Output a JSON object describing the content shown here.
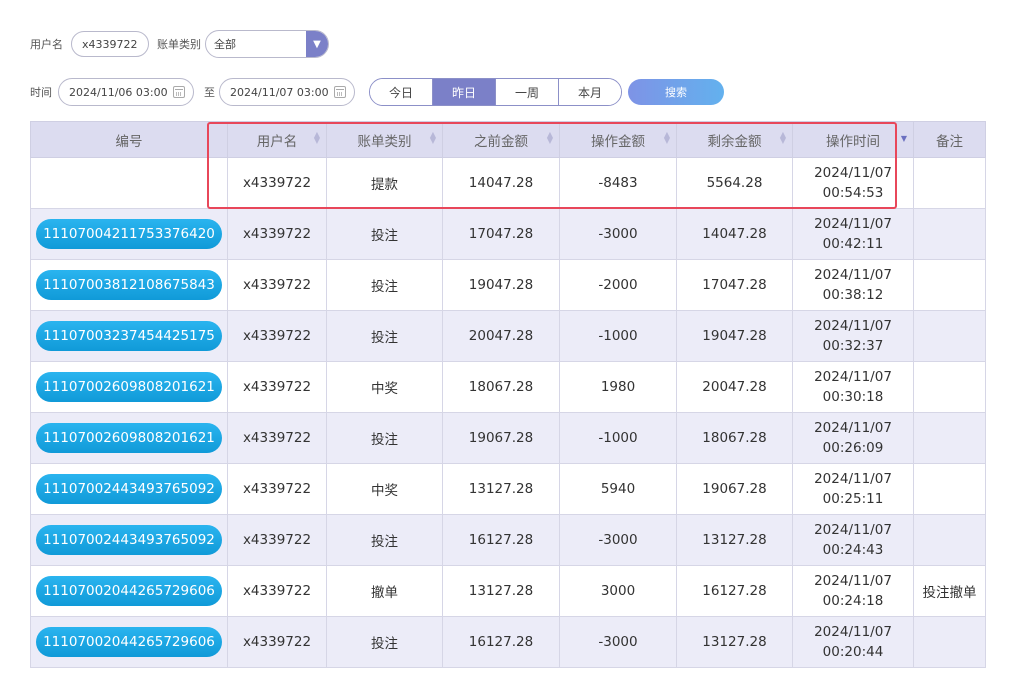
{
  "filters": {
    "username_label": "用户名",
    "username_value": "x4339722",
    "category_label": "账单类别",
    "category_value": "全部",
    "time_label": "时间",
    "start_date": "2024/11/06 03:00",
    "to_label": "至",
    "end_date": "2024/11/07 03:00",
    "quick_ranges": [
      "今日",
      "昨日",
      "一周",
      "本月"
    ],
    "active_range": "昨日",
    "search_label": "搜索"
  },
  "table": {
    "columns": [
      "编号",
      "用户名",
      "账单类别",
      "之前金额",
      "操作金额",
      "剩余金额",
      "操作时间",
      "备注"
    ],
    "rows": [
      {
        "id": "",
        "user": "x4339722",
        "type": "提款",
        "before": "14047.28",
        "amount": "-8483",
        "after": "5564.28",
        "date": "2024/11/07",
        "time": "00:54:53",
        "note": ""
      },
      {
        "id": "11107004211753376420",
        "user": "x4339722",
        "type": "投注",
        "before": "17047.28",
        "amount": "-3000",
        "after": "14047.28",
        "date": "2024/11/07",
        "time": "00:42:11",
        "note": ""
      },
      {
        "id": "11107003812108675843",
        "user": "x4339722",
        "type": "投注",
        "before": "19047.28",
        "amount": "-2000",
        "after": "17047.28",
        "date": "2024/11/07",
        "time": "00:38:12",
        "note": ""
      },
      {
        "id": "11107003237454425175",
        "user": "x4339722",
        "type": "投注",
        "before": "20047.28",
        "amount": "-1000",
        "after": "19047.28",
        "date": "2024/11/07",
        "time": "00:32:37",
        "note": ""
      },
      {
        "id": "11107002609808201621",
        "user": "x4339722",
        "type": "中奖",
        "before": "18067.28",
        "amount": "1980",
        "after": "20047.28",
        "date": "2024/11/07",
        "time": "00:30:18",
        "note": ""
      },
      {
        "id": "11107002609808201621",
        "user": "x4339722",
        "type": "投注",
        "before": "19067.28",
        "amount": "-1000",
        "after": "18067.28",
        "date": "2024/11/07",
        "time": "00:26:09",
        "note": ""
      },
      {
        "id": "11107002443493765092",
        "user": "x4339722",
        "type": "中奖",
        "before": "13127.28",
        "amount": "5940",
        "after": "19067.28",
        "date": "2024/11/07",
        "time": "00:25:11",
        "note": ""
      },
      {
        "id": "11107002443493765092",
        "user": "x4339722",
        "type": "投注",
        "before": "16127.28",
        "amount": "-3000",
        "after": "13127.28",
        "date": "2024/11/07",
        "time": "00:24:43",
        "note": ""
      },
      {
        "id": "11107002044265729606",
        "user": "x4339722",
        "type": "撤单",
        "before": "13127.28",
        "amount": "3000",
        "after": "16127.28",
        "date": "2024/11/07",
        "time": "00:24:18",
        "note": "投注撤单"
      },
      {
        "id": "11107002044265729606",
        "user": "x4339722",
        "type": "投注",
        "before": "16127.28",
        "amount": "-3000",
        "after": "13127.28",
        "date": "2024/11/07",
        "time": "00:20:44",
        "note": ""
      }
    ]
  },
  "colors": {
    "accent": "#7b80c8",
    "id_button": "#1aa7e6",
    "highlight_box": "#e8475a",
    "header_bg": "#dcdcf0"
  },
  "icons": {
    "category_dropdown": "chevron-down-icon",
    "date_picker": "calendar-icon",
    "sort": "sort-icon"
  }
}
